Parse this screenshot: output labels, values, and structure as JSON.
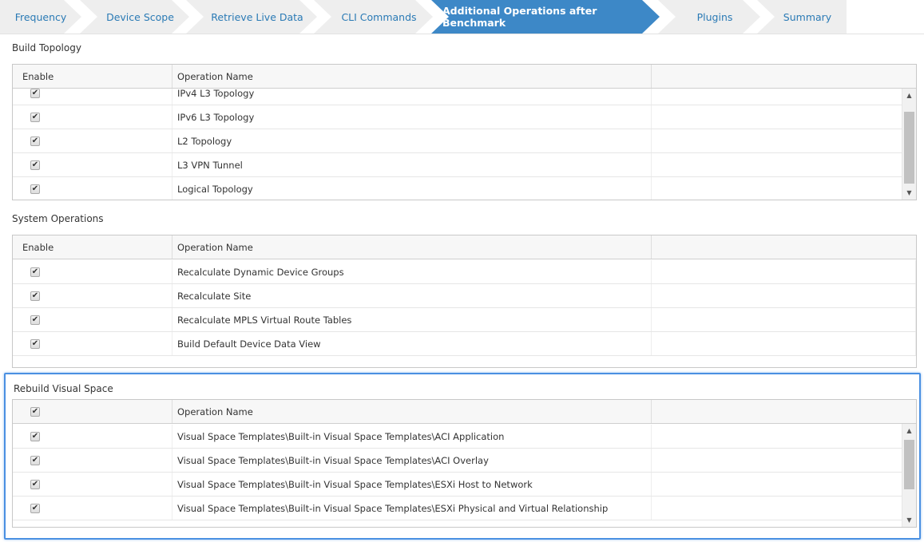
{
  "tabs": [
    {
      "label": "Frequency",
      "active": false
    },
    {
      "label": "Device Scope",
      "active": false
    },
    {
      "label": "Retrieve Live Data",
      "active": false
    },
    {
      "label": "CLI Commands",
      "active": false
    },
    {
      "label": "Additional Operations after Benchmark",
      "active": true
    },
    {
      "label": "Plugins",
      "active": false
    },
    {
      "label": "Summary",
      "active": false
    }
  ],
  "colors": {
    "active_tab": "#3d88c7",
    "tab_text": "#2a7ab5",
    "highlight_border": "#4a90e2"
  },
  "build_topology": {
    "title": "Build Topology",
    "headers": [
      "Enable",
      "Operation Name"
    ],
    "rows": [
      {
        "enabled": true,
        "name": "IPv4 L3 Topology"
      },
      {
        "enabled": true,
        "name": "IPv6 L3 Topology"
      },
      {
        "enabled": true,
        "name": "L2 Topology"
      },
      {
        "enabled": true,
        "name": "L3 VPN Tunnel"
      },
      {
        "enabled": true,
        "name": "Logical Topology"
      }
    ]
  },
  "system_operations": {
    "title": "System Operations",
    "headers": [
      "Enable",
      "Operation Name"
    ],
    "rows": [
      {
        "enabled": true,
        "name": "Recalculate Dynamic Device Groups"
      },
      {
        "enabled": true,
        "name": "Recalculate Site"
      },
      {
        "enabled": true,
        "name": "Recalculate MPLS Virtual Route Tables"
      },
      {
        "enabled": true,
        "name": "Build Default Device Data View"
      }
    ]
  },
  "rebuild_visual_space": {
    "title": "Rebuild Visual Space",
    "header_checkbox": true,
    "headers": [
      "",
      "Operation Name"
    ],
    "rows": [
      {
        "enabled": true,
        "name": "Visual Space Templates\\Built-in Visual Space Templates\\ACI Application"
      },
      {
        "enabled": true,
        "name": "Visual Space Templates\\Built-in Visual Space Templates\\ACI Overlay"
      },
      {
        "enabled": true,
        "name": "Visual Space Templates\\Built-in Visual Space Templates\\ESXi Host to Network"
      },
      {
        "enabled": true,
        "name": "Visual Space Templates\\Built-in Visual Space Templates\\ESXi Physical and Virtual Relationship"
      }
    ]
  }
}
